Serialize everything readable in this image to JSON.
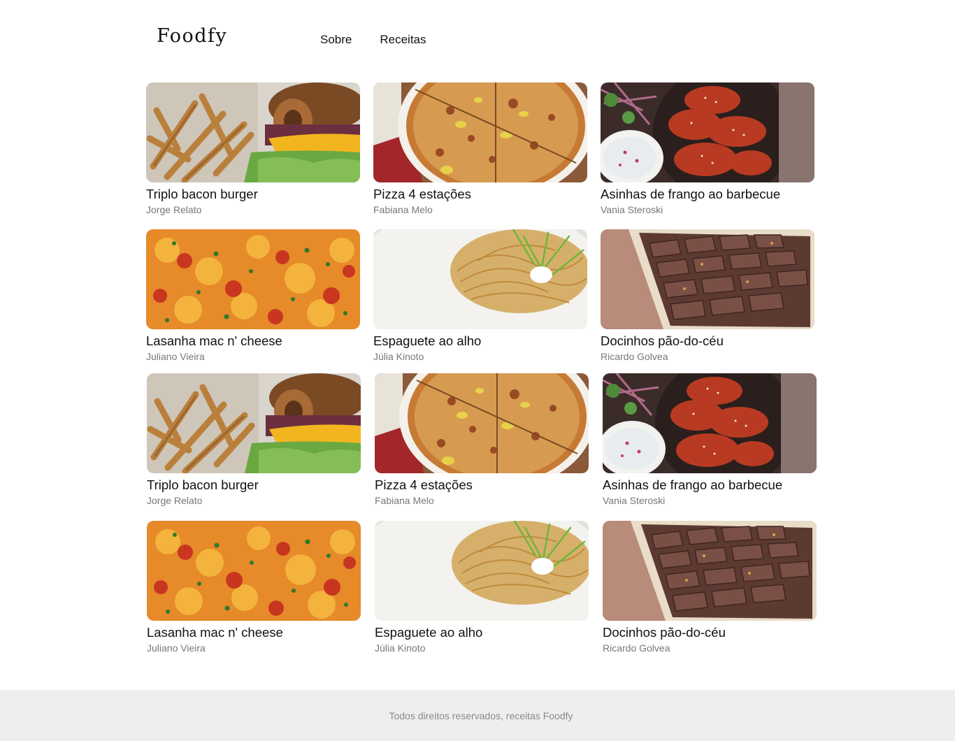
{
  "header": {
    "logo": "Foodfy",
    "nav": [
      {
        "label": "Sobre"
      },
      {
        "label": "Receitas"
      }
    ]
  },
  "recipes": [
    {
      "title": "Triplo bacon burger",
      "author": "Jorge Relato",
      "image": "burger-photo"
    },
    {
      "title": "Pizza 4 estações",
      "author": "Fabiana Melo",
      "image": "pizza-photo"
    },
    {
      "title": "Asinhas de frango ao barbecue",
      "author": "Vania Steroski",
      "image": "chicken-wings-photo"
    },
    {
      "title": "Lasanha mac n' cheese",
      "author": "Juliano Vieira",
      "image": "lasagna-photo"
    },
    {
      "title": "Espaguete ao alho",
      "author": "Júlia Kinoto",
      "image": "spaghetti-photo"
    },
    {
      "title": "Docinhos pão-do-céu",
      "author": "Ricardo Golvea",
      "image": "chocolates-photo"
    },
    {
      "title": "Triplo bacon burger",
      "author": "Jorge Relato",
      "image": "burger-photo"
    },
    {
      "title": "Pizza 4 estações",
      "author": "Fabiana Melo",
      "image": "pizza-photo"
    },
    {
      "title": "Asinhas de frango ao barbecue",
      "author": "Vania Steroski",
      "image": "chicken-wings-photo"
    },
    {
      "title": "Lasanha mac n' cheese",
      "author": "Juliano Vieira",
      "image": "lasagna-photo"
    },
    {
      "title": "Espaguete ao alho",
      "author": "Júlia Kinoto",
      "image": "spaghetti-photo"
    },
    {
      "title": "Docinhos pão-do-céu",
      "author": "Ricardo Golvea",
      "image": "chocolates-photo"
    }
  ],
  "footer": {
    "text": "Todos direitos reservados, receitas Foodfy"
  }
}
